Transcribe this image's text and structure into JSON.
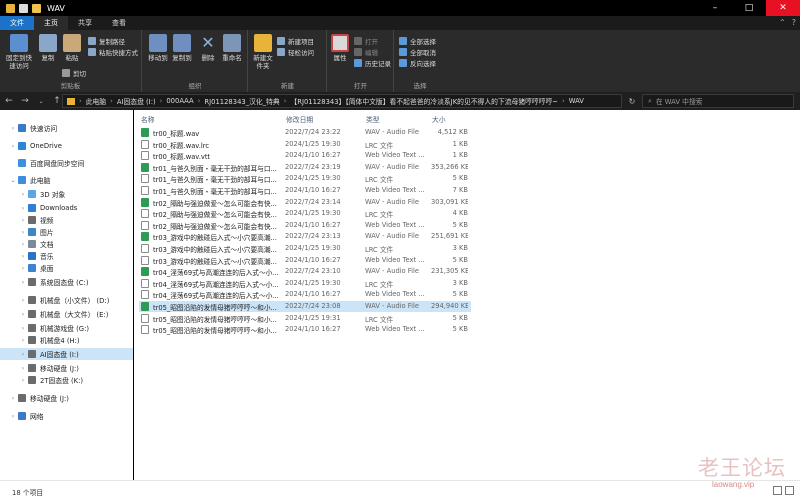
{
  "window": {
    "title": "WAV",
    "controls": {
      "minimize": "–",
      "maximize": "□",
      "close": "✕"
    }
  },
  "ribbon_tabs": {
    "file": "文件",
    "home": "主页",
    "share": "共享",
    "view": "查看"
  },
  "ribbon": {
    "clipboard": {
      "pin": "固定到快速访问",
      "copy": "复制",
      "paste": "粘贴",
      "copy_path": "复制路径",
      "paste_shortcut": "粘贴快捷方式",
      "cut": "剪切",
      "label": "剪贴板"
    },
    "organize": {
      "move_to": "移动到",
      "copy_to": "复制到",
      "delete": "删除",
      "rename": "重命名",
      "label": "组织"
    },
    "new": {
      "new_folder": "新建文件夹",
      "new_item": "新建项目",
      "easy_access": "轻松访问",
      "label": "新建"
    },
    "open": {
      "properties": "属性",
      "open": "打开",
      "edit": "编辑",
      "history": "历史记录",
      "label": "打开"
    },
    "select": {
      "select_all": "全部选择",
      "select_none": "全部取消",
      "invert": "反向选择",
      "label": "选择"
    }
  },
  "address": {
    "segments": [
      "此电脑",
      "AI固态盘 (I:)",
      "000AAA",
      "RJ01128343_汉化_特典",
      "【RJ01128343】【简体中文版】看不起爸爸的冷淡系JK的见不得人的下流母猪哼哼哼哼~",
      "WAV"
    ],
    "search_placeholder": "在 WAV 中搜索"
  },
  "nav": [
    {
      "label": "快速访问",
      "icon": "star-icon",
      "color": "#3a78c9",
      "level": 0,
      "chev": "›"
    },
    {
      "label": "OneDrive",
      "icon": "cloud-icon",
      "color": "#2a86d6",
      "level": 0,
      "chev": "›"
    },
    {
      "label": "百度网盘同步空间",
      "icon": "cloud-folder-icon",
      "color": "#3c8fe3",
      "level": 0,
      "chev": ""
    },
    {
      "label": "此电脑",
      "icon": "computer-icon",
      "color": "#3d8ee0",
      "level": 0,
      "chev": "⌄"
    },
    {
      "label": "3D 对象",
      "icon": "3d-objects-icon",
      "color": "#5aa7e8",
      "level": 1,
      "chev": "›"
    },
    {
      "label": "Downloads",
      "icon": "download-icon",
      "color": "#2c7fd1",
      "level": 1,
      "chev": "›"
    },
    {
      "label": "视频",
      "icon": "video-icon",
      "color": "#6b6b6b",
      "level": 1,
      "chev": "›"
    },
    {
      "label": "图片",
      "icon": "pictures-icon",
      "color": "#3b87c7",
      "level": 1,
      "chev": "›"
    },
    {
      "label": "文档",
      "icon": "documents-icon",
      "color": "#7b8b9b",
      "level": 1,
      "chev": "›"
    },
    {
      "label": "音乐",
      "icon": "music-icon",
      "color": "#2b74c4",
      "level": 1,
      "chev": "›"
    },
    {
      "label": "桌面",
      "icon": "desktop-icon",
      "color": "#3a85d2",
      "level": 1,
      "chev": "›"
    },
    {
      "label": "系统固态盘 (C:)",
      "icon": "drive-c-icon",
      "color": "#6b6b6b",
      "level": 1,
      "chev": "›"
    },
    {
      "label": "机械盘（小文件） (D:)",
      "icon": "drive-icon",
      "color": "#6b6b6b",
      "level": 1,
      "chev": "›"
    },
    {
      "label": "机械盘（大文件） (E:)",
      "icon": "drive-icon",
      "color": "#6b6b6b",
      "level": 1,
      "chev": "›"
    },
    {
      "label": "机械游戏盘 (G:)",
      "icon": "drive-icon",
      "color": "#6b6b6b",
      "level": 1,
      "chev": "›"
    },
    {
      "label": "机械盘4 (H:)",
      "icon": "drive-icon",
      "color": "#6b6b6b",
      "level": 1,
      "chev": "›"
    },
    {
      "label": "AI固态盘 (I:)",
      "icon": "drive-icon",
      "color": "#6b6b6b",
      "level": 1,
      "chev": "›",
      "selected": true
    },
    {
      "label": "移动硬盘 (J:)",
      "icon": "drive-icon",
      "color": "#6b6b6b",
      "level": 1,
      "chev": "›"
    },
    {
      "label": "2T固态盘 (K:)",
      "icon": "drive-icon",
      "color": "#6b6b6b",
      "level": 1,
      "chev": "›"
    },
    {
      "label": "移动硬盘 (J:)",
      "icon": "usb-drive-icon",
      "color": "#6b6b6b",
      "level": 0,
      "chev": "›"
    },
    {
      "label": "网络",
      "icon": "network-icon",
      "color": "#3a78c9",
      "level": 0,
      "chev": "›"
    }
  ],
  "columns": {
    "name": "名称",
    "date": "修改日期",
    "type": "类型",
    "size": "大小"
  },
  "files": [
    {
      "name": "tr00_标题.wav",
      "date": "2022/7/24 23:22",
      "type": "WAV - Audio File",
      "size": "4,512 KB",
      "kind": "wav"
    },
    {
      "name": "tr00_标题.wav.lrc",
      "date": "2024/1/25 19:30",
      "type": "LRC 文件",
      "size": "1 KB",
      "kind": "txt"
    },
    {
      "name": "tr00_标题.wav.vtt",
      "date": "2024/1/10 16:27",
      "type": "Web Video Text ...",
      "size": "1 KB",
      "kind": "txt"
    },
    {
      "name": "tr01_与爸久别面・毫无干劲的部耳与口...",
      "date": "2022/7/24 23:19",
      "type": "WAV - Audio File",
      "size": "353,266 KB",
      "kind": "wav"
    },
    {
      "name": "tr01_与爸久别面・毫无干劲的部耳与口...",
      "date": "2024/1/25 19:30",
      "type": "LRC 文件",
      "size": "5 KB",
      "kind": "txt"
    },
    {
      "name": "tr01_与爸久别面・毫无干劲的部耳与口...",
      "date": "2024/1/10 16:27",
      "type": "Web Video Text ...",
      "size": "7 KB",
      "kind": "txt"
    },
    {
      "name": "tr02_隔助与强迫做爱～怎么可能会有快...",
      "date": "2022/7/24 23:14",
      "type": "WAV - Audio File",
      "size": "303,091 KB",
      "kind": "wav"
    },
    {
      "name": "tr02_隔助与强迫做爱～怎么可能会有快...",
      "date": "2024/1/25 19:30",
      "type": "LRC 文件",
      "size": "4 KB",
      "kind": "txt"
    },
    {
      "name": "tr02_隔助与强迫做爱～怎么可能会有快...",
      "date": "2024/1/10 16:27",
      "type": "Web Video Text ...",
      "size": "5 KB",
      "kind": "txt"
    },
    {
      "name": "tr03_游戏中的触碰后入式～小穴要高潮...",
      "date": "2022/7/24 23:13",
      "type": "WAV - Audio File",
      "size": "251,691 KB",
      "kind": "wav"
    },
    {
      "name": "tr03_游戏中的触碰后入式～小穴要高潮...",
      "date": "2024/1/25 19:30",
      "type": "LRC 文件",
      "size": "3 KB",
      "kind": "txt"
    },
    {
      "name": "tr03_游戏中的触碰后入式～小穴要高潮...",
      "date": "2024/1/10 16:27",
      "type": "Web Video Text ...",
      "size": "5 KB",
      "kind": "txt"
    },
    {
      "name": "tr04_淫荡69式与高潮连连的后入式～小...",
      "date": "2022/7/24 23:10",
      "type": "WAV - Audio File",
      "size": "231,305 KB",
      "kind": "wav"
    },
    {
      "name": "tr04_淫荡69式与高潮连连的后入式～小...",
      "date": "2024/1/25 19:30",
      "type": "LRC 文件",
      "size": "3 KB",
      "kind": "txt"
    },
    {
      "name": "tr04_淫荡69式与高潮连连的后入式～小...",
      "date": "2024/1/10 16:27",
      "type": "Web Video Text ...",
      "size": "5 KB",
      "kind": "txt"
    },
    {
      "name": "tr05_昭图沿陷的发情母猪哼哼哼～和小...",
      "date": "2022/7/24 23:08",
      "type": "WAV - Audio File",
      "size": "294,940 KB",
      "kind": "wav",
      "selected": true
    },
    {
      "name": "tr05_昭图沿陷的发情母猪哼哼哼～和小...",
      "date": "2024/1/25 19:31",
      "type": "LRC 文件",
      "size": "5 KB",
      "kind": "txt"
    },
    {
      "name": "tr05_昭图沿陷的发情母猪哼哼哼～和小...",
      "date": "2024/1/10 16:27",
      "type": "Web Video Text ...",
      "size": "5 KB",
      "kind": "txt"
    }
  ],
  "status": {
    "count": "18 个项目"
  },
  "watermark": {
    "cn": "老王论坛",
    "en": "laowang.vip"
  }
}
